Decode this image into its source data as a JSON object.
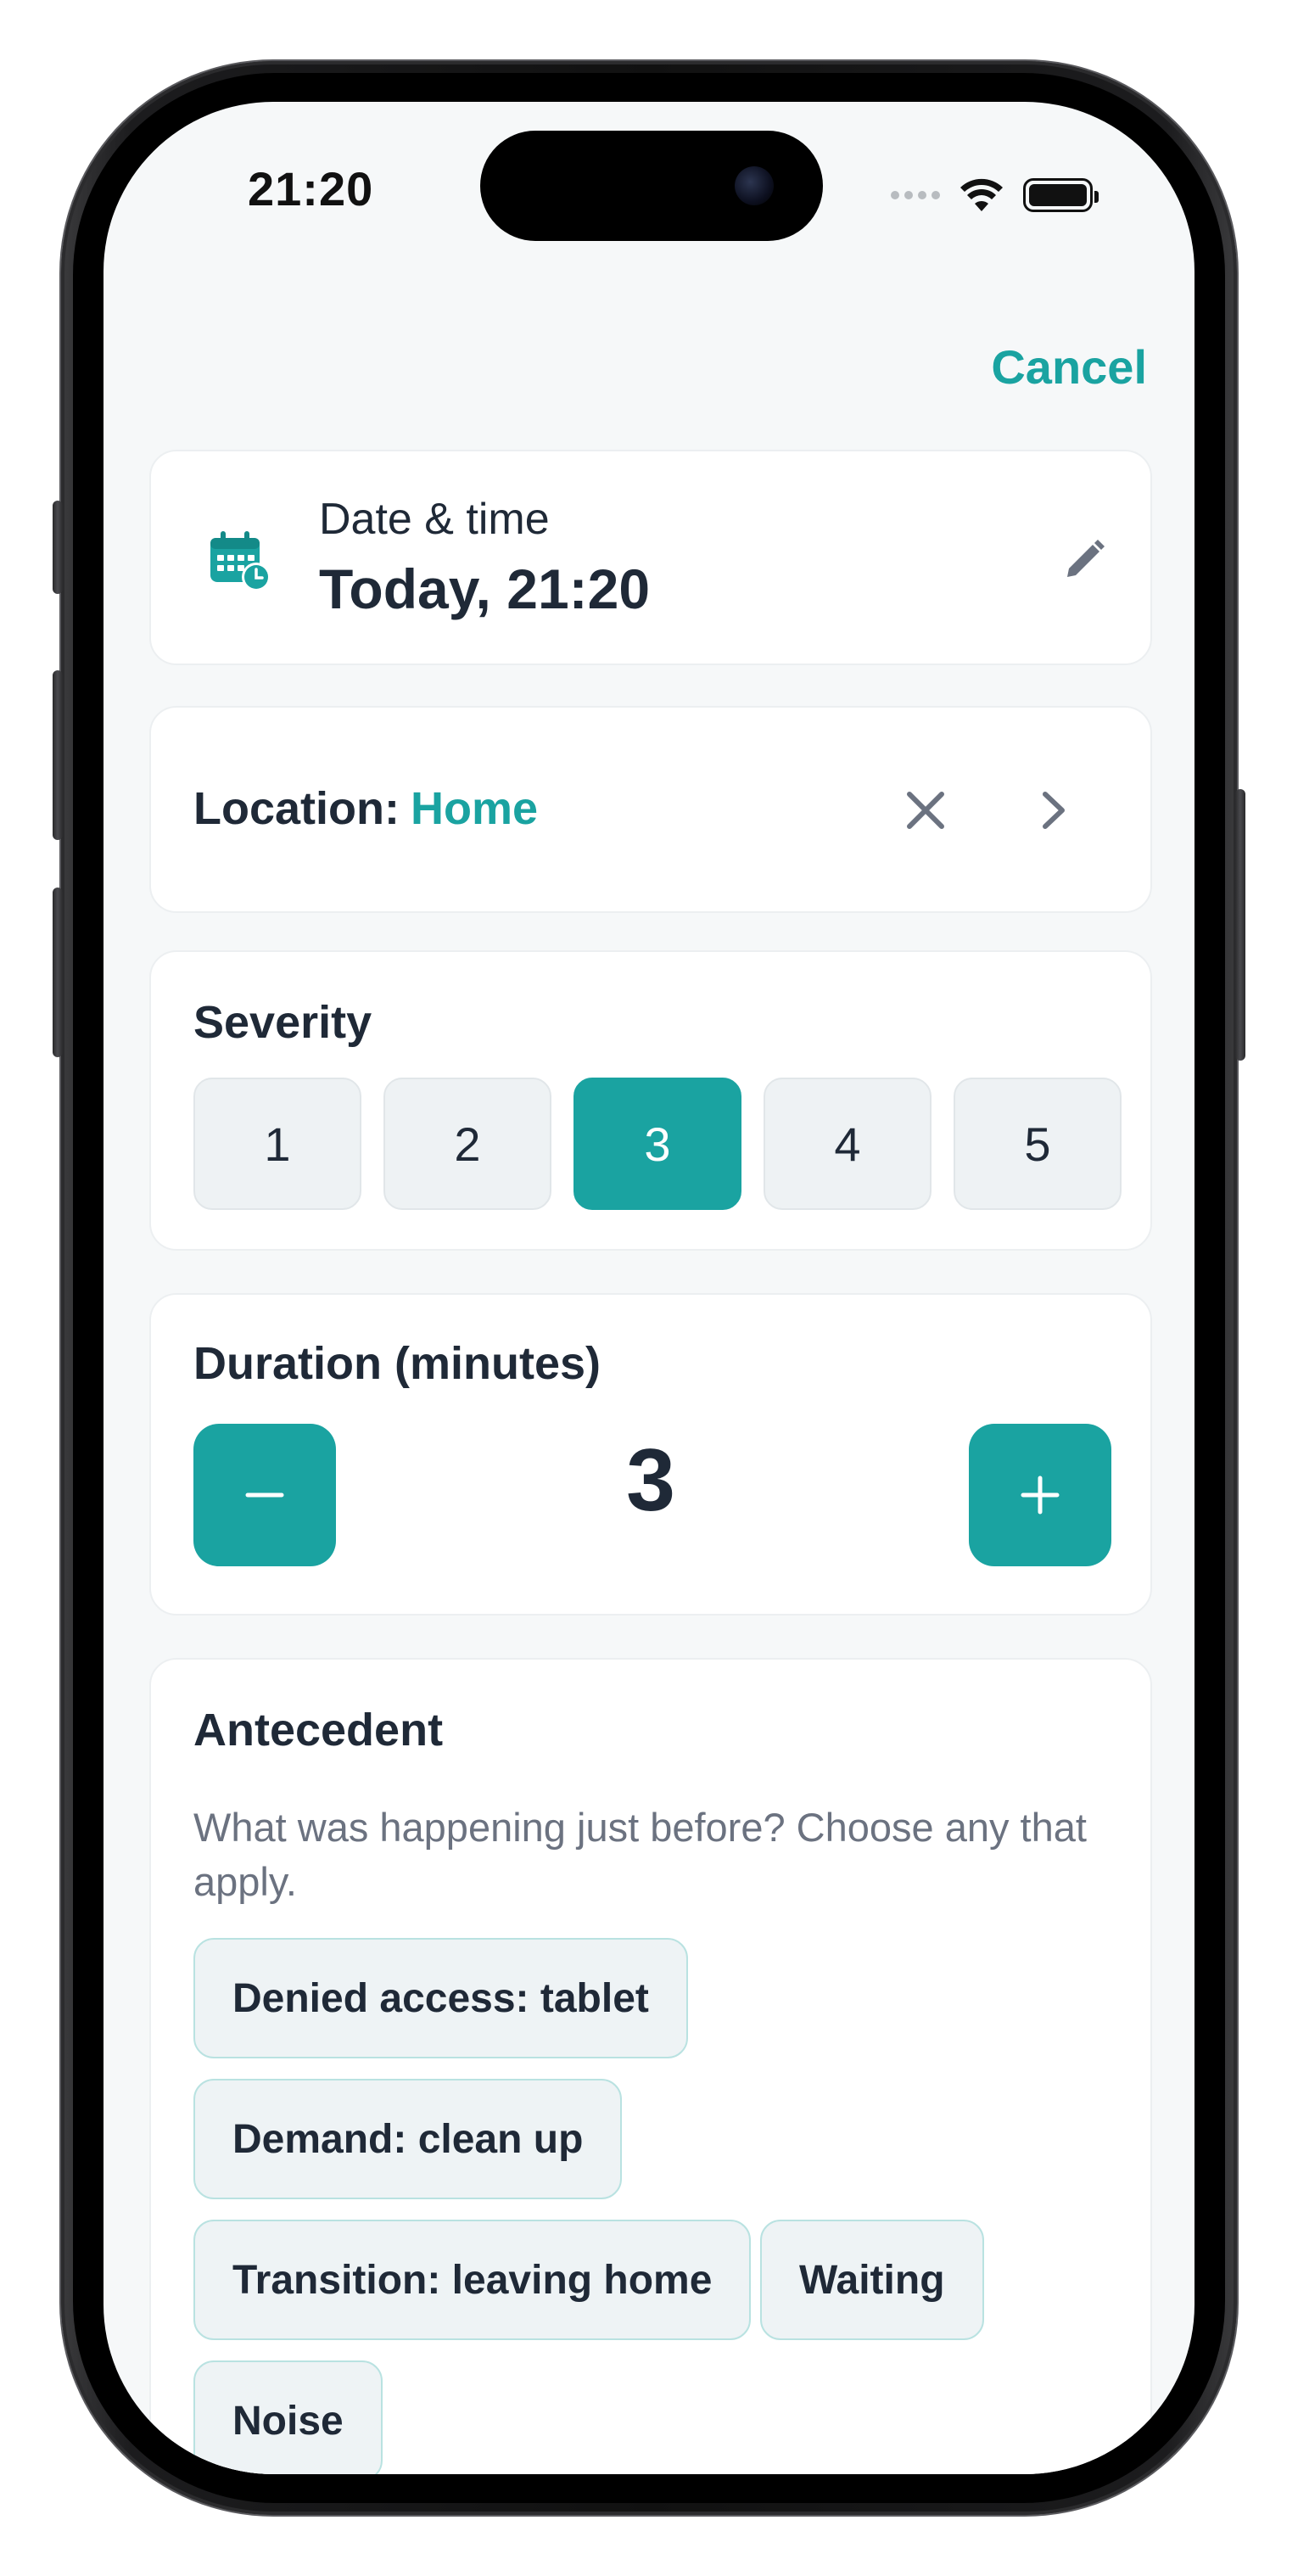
{
  "status_bar": {
    "time": "21:20"
  },
  "header": {
    "cancel_label": "Cancel"
  },
  "date_time": {
    "label": "Date & time",
    "value": "Today, 21:20",
    "icon": "calendar-clock-icon"
  },
  "location": {
    "label": "Location:",
    "value": "Home"
  },
  "severity": {
    "title": "Severity",
    "options": [
      "1",
      "2",
      "3",
      "4",
      "5"
    ],
    "selected": "3"
  },
  "duration": {
    "title": "Duration (minutes)",
    "value": "3",
    "minus_label": "−",
    "plus_label": "+"
  },
  "antecedent": {
    "title": "Antecedent",
    "subtitle": "What was happening just before? Choose any that apply.",
    "chips": [
      "Denied access: tablet",
      "Demand: clean up",
      "Transition: leaving home",
      "Waiting",
      "Noise"
    ]
  },
  "colors": {
    "accent": "#1aa3a1",
    "text": "#1f2937",
    "muted": "#6b7280",
    "chip_bg": "#eef3f5",
    "chip_border": "#b9e2e1",
    "background": "#f6f8f9"
  }
}
